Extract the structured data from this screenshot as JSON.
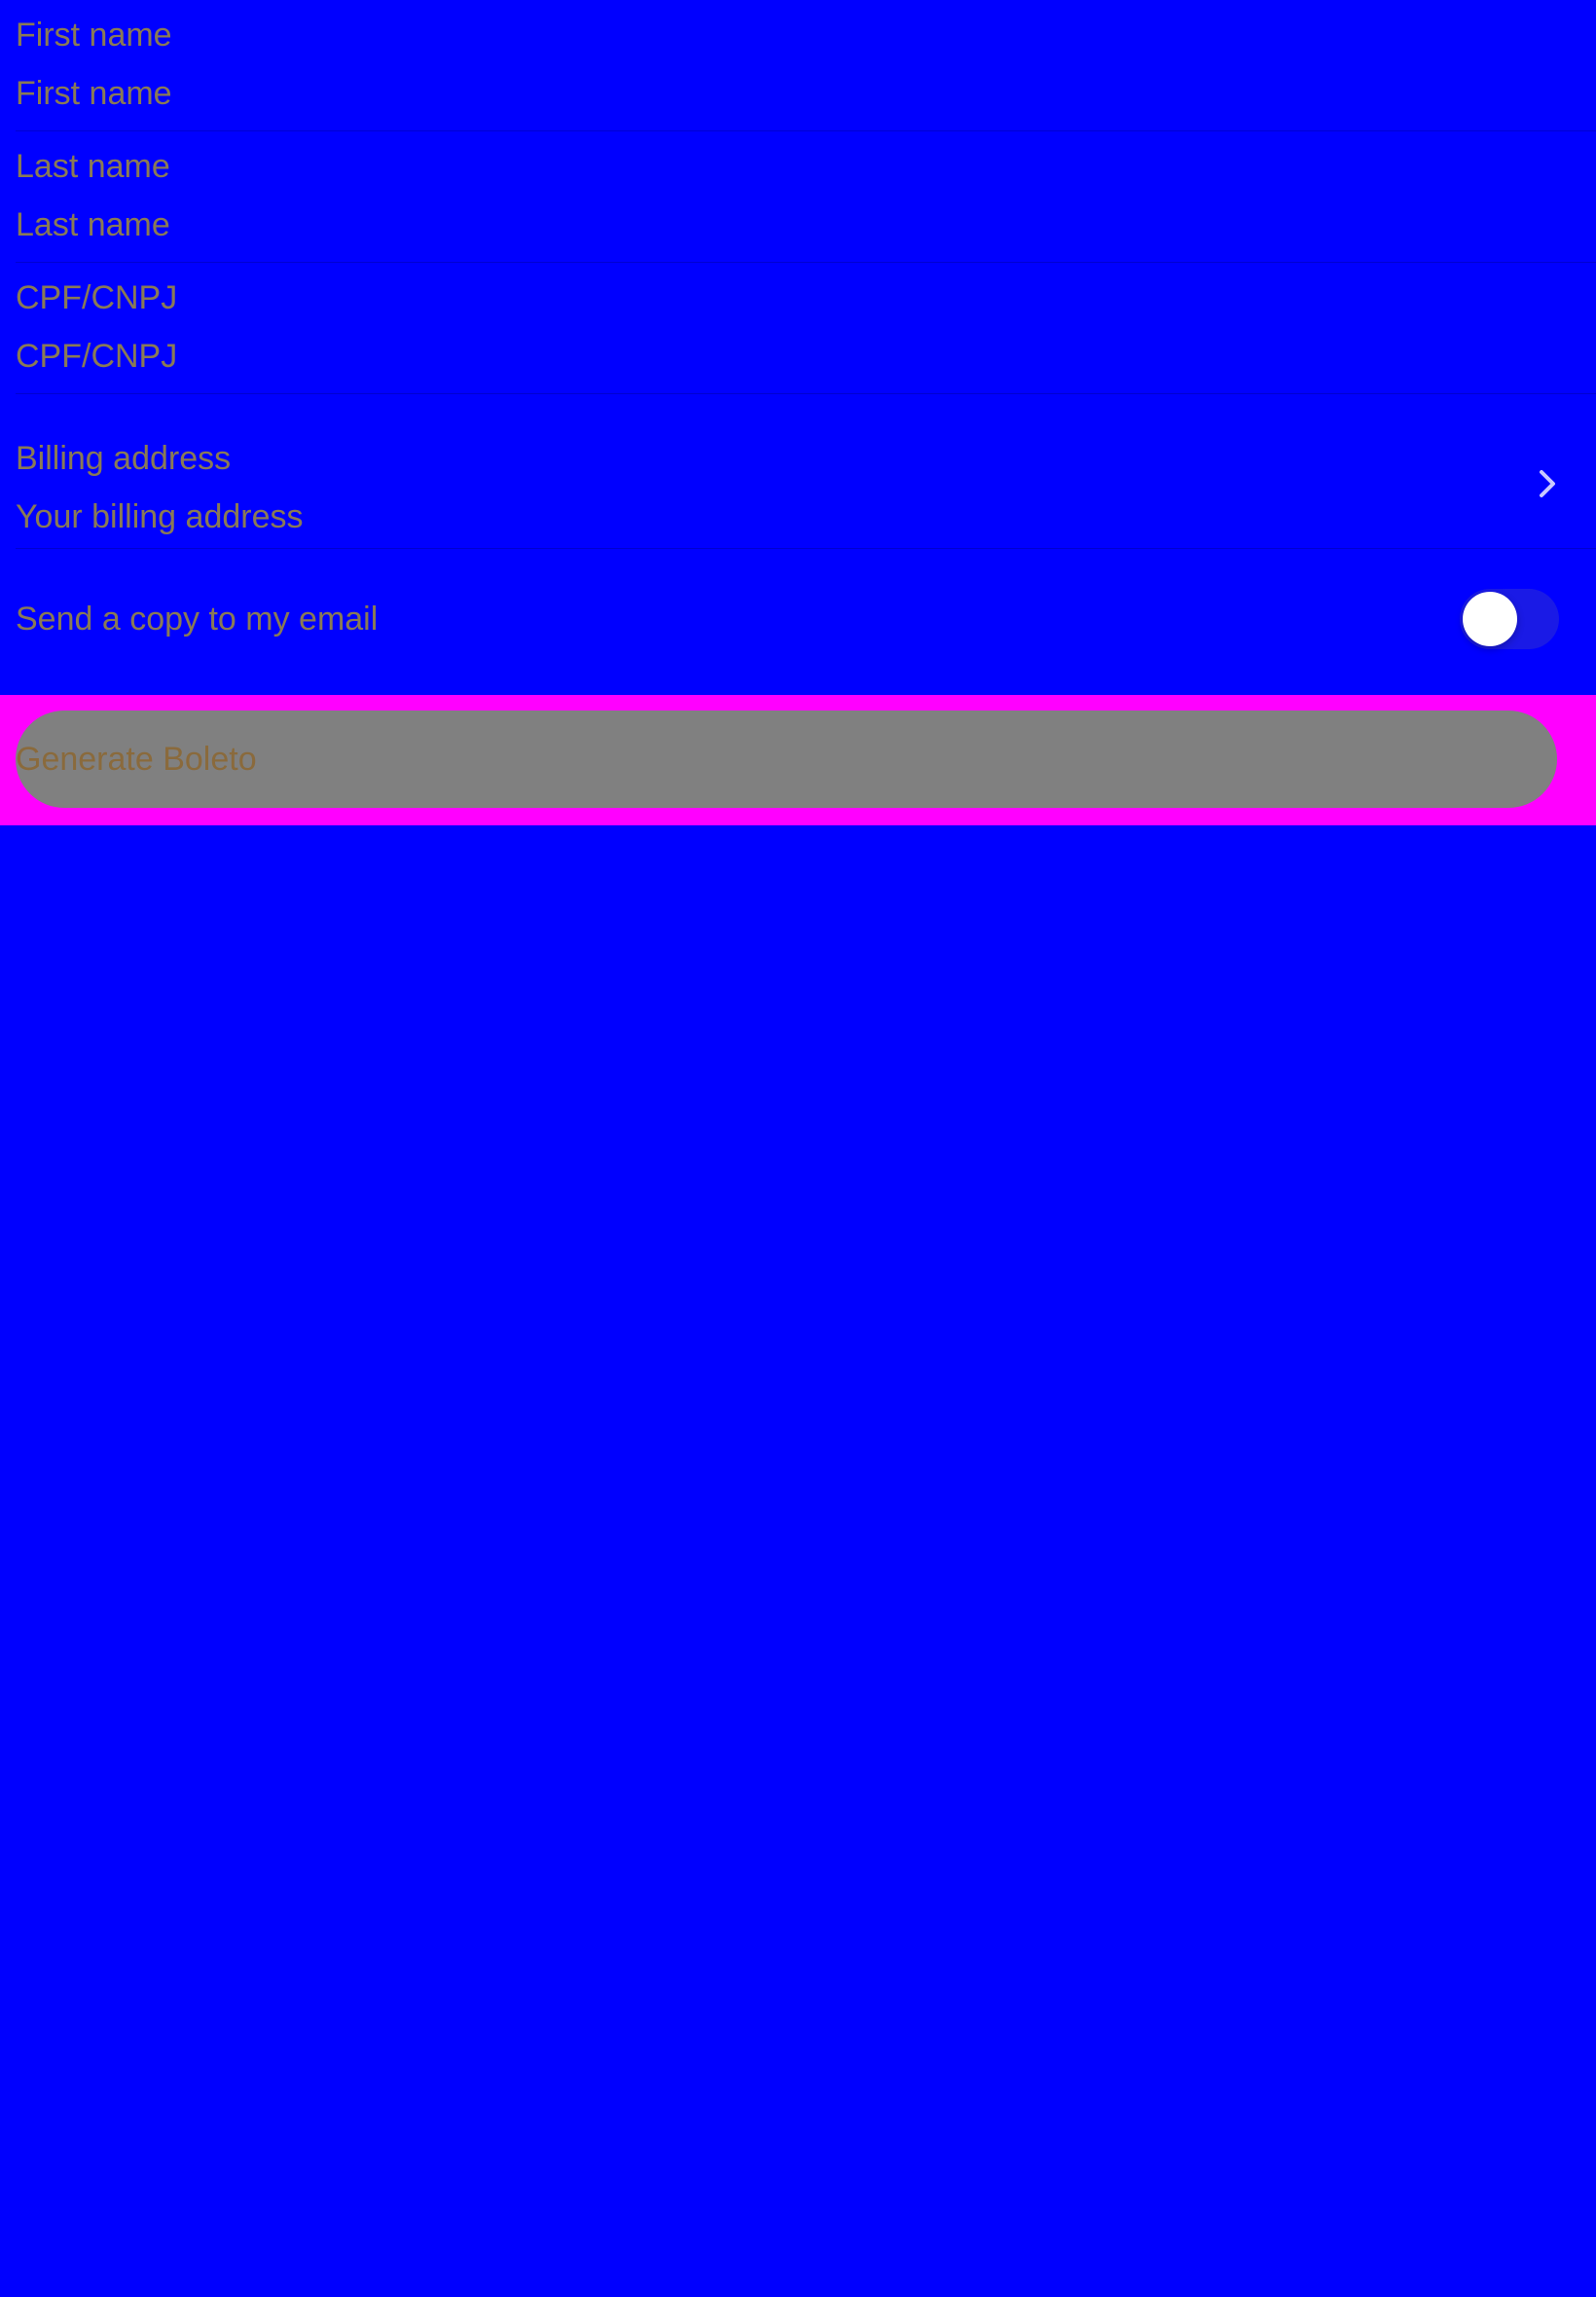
{
  "form": {
    "first_name": {
      "label": "First name",
      "placeholder": "First name",
      "value": ""
    },
    "last_name": {
      "label": "Last name",
      "placeholder": "Last name",
      "value": ""
    },
    "document": {
      "label": "CPF/CNPJ",
      "placeholder": "CPF/CNPJ",
      "value": ""
    },
    "billing": {
      "label": "Billing address",
      "value": "Your billing address",
      "icon": "chevron-right-icon"
    },
    "email_copy": {
      "label": "Send a copy to my email",
      "enabled": false
    }
  },
  "actions": {
    "generate_label": "Generate Boleto"
  },
  "colors": {
    "background": "#0000ff",
    "text": "#8a7a55",
    "button_bar": "#ff00ff",
    "button": "#808080",
    "button_text": "#8a6a3c",
    "toggle_track": "#1a1ae6",
    "chevron": "#c8c8ff"
  }
}
